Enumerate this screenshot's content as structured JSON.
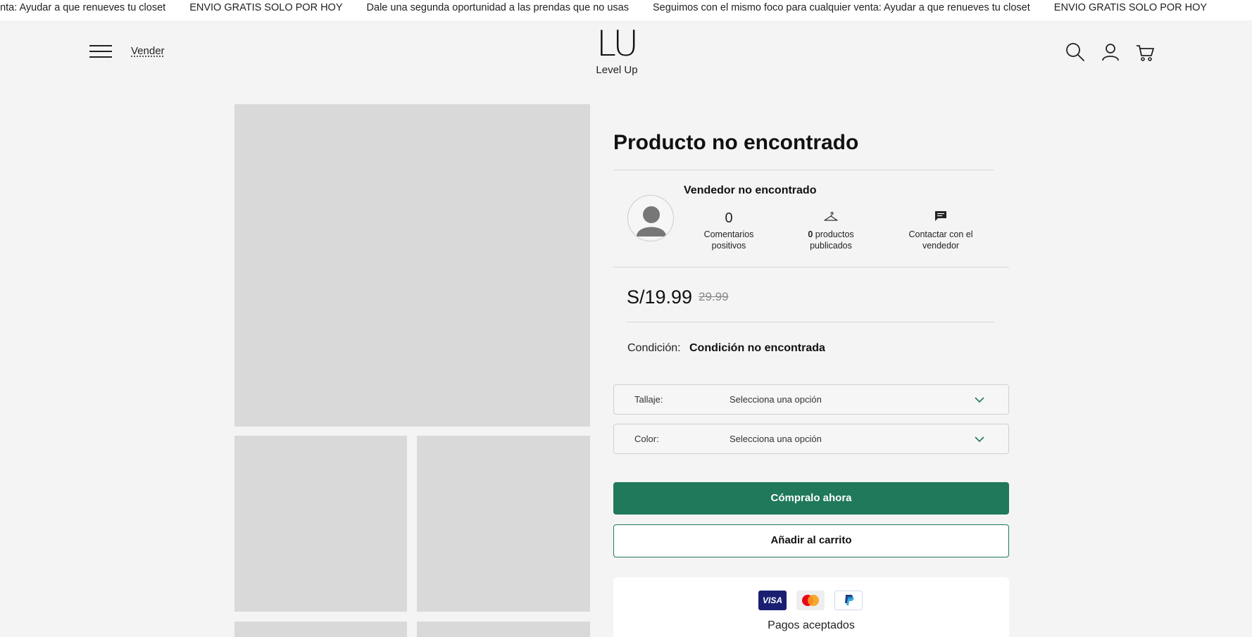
{
  "announcement": {
    "items": [
      "enta: Ayudar a que renueves tu closet",
      "ENVIO GRATIS SOLO POR HOY",
      "Dale una segunda oportunidad a las prendas que no usas",
      "Seguimos con el mismo foco para cualquier venta: Ayudar a que renueves tu closet",
      "ENVIO GRATIS SOLO POR HOY"
    ]
  },
  "header": {
    "menu_icon": "hamburger-icon",
    "vender_label": "Vender",
    "logo_mark": "LU",
    "logo_text": "Level Up",
    "icons": [
      "search-icon",
      "user-icon",
      "cart-icon"
    ]
  },
  "product": {
    "title": "Producto no encontrado",
    "price": "S/19.99",
    "old_price": "29.99",
    "condition_label": "Condición:",
    "condition_value": "Condición no encontrada"
  },
  "seller": {
    "name": "Vendedor no encontrado",
    "comments_count": "0",
    "comments_label_1": "Comentarios",
    "comments_label_2": "positivos",
    "products_count": "0",
    "products_label_1": "productos",
    "products_label_2": "publicados",
    "contact_label_1": "Contactar con el",
    "contact_label_2": "vendedor"
  },
  "options": {
    "size_label": "Tallaje:",
    "size_value": "Selecciona una opción",
    "color_label": "Color:",
    "color_value": "Selecciona una opción"
  },
  "actions": {
    "buy_label": "Cómpralo ahora",
    "cart_label": "Añadir al carrito"
  },
  "payments": {
    "cards": [
      "visa",
      "mastercard",
      "paypal"
    ],
    "visa_text": "VISA",
    "label": "Pagos aceptados"
  },
  "colors": {
    "accent": "#20795a",
    "background": "#f4f4f4",
    "placeholder": "#d9d9d9"
  }
}
